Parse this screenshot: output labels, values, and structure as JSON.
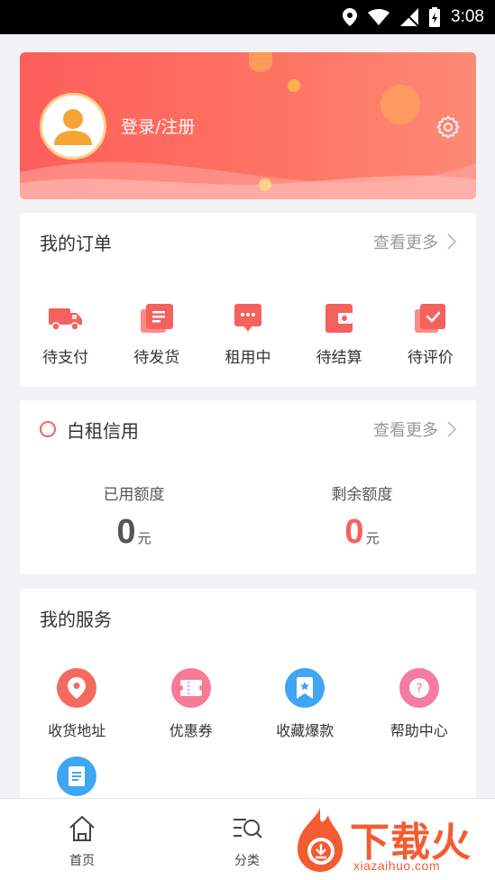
{
  "status_bar": {
    "time": "3:08",
    "icons": [
      "location-icon",
      "wifi-icon",
      "signal-icon",
      "battery-icon"
    ]
  },
  "profile": {
    "login_label": "登录/注册",
    "settings_icon": "gear-icon",
    "avatar_icon": "user-avatar-icon"
  },
  "orders": {
    "title": "我的订单",
    "more": "查看更多",
    "items": [
      {
        "label": "待支付",
        "icon": "truck-icon"
      },
      {
        "label": "待发货",
        "icon": "document-icon"
      },
      {
        "label": "租用中",
        "icon": "chat-icon"
      },
      {
        "label": "待结算",
        "icon": "wallet-icon"
      },
      {
        "label": "待评价",
        "icon": "check-icon"
      }
    ]
  },
  "credit": {
    "title": "白租信用",
    "more": "查看更多",
    "used_label": "已用额度",
    "used_value": "0",
    "used_unit": "元",
    "remain_label": "剩余额度",
    "remain_value": "0",
    "remain_unit": "元"
  },
  "services": {
    "title": "我的服务",
    "items": [
      {
        "label": "收货地址",
        "icon": "location-pin-icon",
        "color": "#f56a5e"
      },
      {
        "label": "优惠券",
        "icon": "coupon-icon",
        "color": "#f87a96"
      },
      {
        "label": "收藏爆款",
        "icon": "bookmark-icon",
        "color": "#3ea6f2"
      },
      {
        "label": "帮助中心",
        "icon": "help-icon",
        "color": "#f67ba3"
      },
      {
        "label": "",
        "icon": "note-icon",
        "color": "#3ea6f2"
      }
    ]
  },
  "tabs": [
    {
      "label": "首页",
      "icon": "home-icon"
    },
    {
      "label": "分类",
      "icon": "category-search-icon"
    }
  ],
  "watermark": {
    "text": "下载火",
    "url": "xiazaihuo.com"
  },
  "colors": {
    "accent": "#f5615c",
    "card_gradient_start": "#fe5e5b",
    "card_gradient_end": "#fd8a76"
  }
}
